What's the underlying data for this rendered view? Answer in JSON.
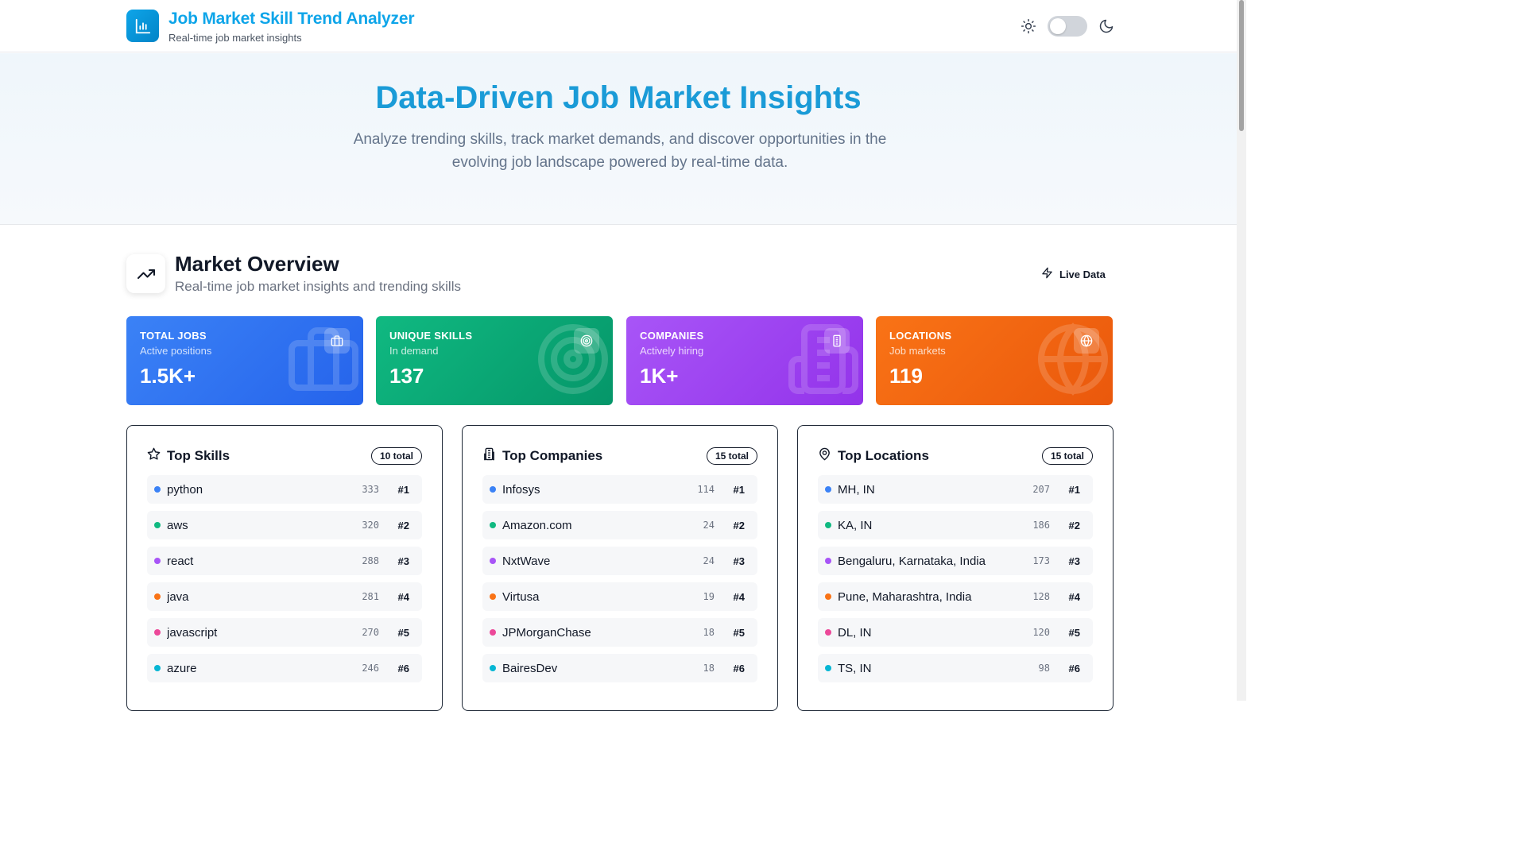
{
  "header": {
    "title": "Job Market Skill Trend Analyzer",
    "subtitle": "Real-time job market insights",
    "logo_icon": "bar-chart-icon"
  },
  "hero": {
    "title": "Data-Driven Job Market Insights",
    "text": "Analyze trending skills, track market demands, and discover opportunities in the evolving job landscape powered by real-time data."
  },
  "overview": {
    "title": "Market Overview",
    "subtitle": "Real-time job market insights and trending skills",
    "live_label": "Live Data"
  },
  "stats": [
    {
      "label": "Total Jobs",
      "sub": "Active positions",
      "value": "1.5K+",
      "icon": "briefcase-icon",
      "color": "#2563eb"
    },
    {
      "label": "Unique Skills",
      "sub": "In demand",
      "value": "137",
      "icon": "target-icon",
      "color": "#059669"
    },
    {
      "label": "Companies",
      "sub": "Actively hiring",
      "value": "1K+",
      "icon": "building-icon",
      "color": "#9333ea"
    },
    {
      "label": "Locations",
      "sub": "Job markets",
      "value": "119",
      "icon": "globe-icon",
      "color": "#ea580c"
    }
  ],
  "dot_colors": [
    "#3b82f6",
    "#10b981",
    "#a855f7",
    "#f97316",
    "#ec4899",
    "#06b6d4"
  ],
  "panels": {
    "skills": {
      "title": "Top Skills",
      "count": "10 total",
      "icon": "star-icon",
      "items": [
        {
          "name": "python",
          "value": "333",
          "rank": "#1"
        },
        {
          "name": "aws",
          "value": "320",
          "rank": "#2"
        },
        {
          "name": "react",
          "value": "288",
          "rank": "#3"
        },
        {
          "name": "java",
          "value": "281",
          "rank": "#4"
        },
        {
          "name": "javascript",
          "value": "270",
          "rank": "#5"
        },
        {
          "name": "azure",
          "value": "246",
          "rank": "#6"
        }
      ]
    },
    "companies": {
      "title": "Top Companies",
      "count": "15 total",
      "icon": "building-icon",
      "items": [
        {
          "name": "Infosys",
          "value": "114",
          "rank": "#1"
        },
        {
          "name": "Amazon.com",
          "value": "24",
          "rank": "#2"
        },
        {
          "name": "NxtWave",
          "value": "24",
          "rank": "#3"
        },
        {
          "name": "Virtusa",
          "value": "19",
          "rank": "#4"
        },
        {
          "name": "JPMorganChase",
          "value": "18",
          "rank": "#5"
        },
        {
          "name": "BairesDev",
          "value": "18",
          "rank": "#6"
        }
      ]
    },
    "locations": {
      "title": "Top Locations",
      "count": "15 total",
      "icon": "map-pin-icon",
      "items": [
        {
          "name": "MH, IN",
          "value": "207",
          "rank": "#1"
        },
        {
          "name": "KA, IN",
          "value": "186",
          "rank": "#2"
        },
        {
          "name": "Bengaluru, Karnataka, India",
          "value": "173",
          "rank": "#3"
        },
        {
          "name": "Pune, Maharashtra, India",
          "value": "128",
          "rank": "#4"
        },
        {
          "name": "DL, IN",
          "value": "120",
          "rank": "#5"
        },
        {
          "name": "TS, IN",
          "value": "98",
          "rank": "#6"
        }
      ]
    }
  }
}
